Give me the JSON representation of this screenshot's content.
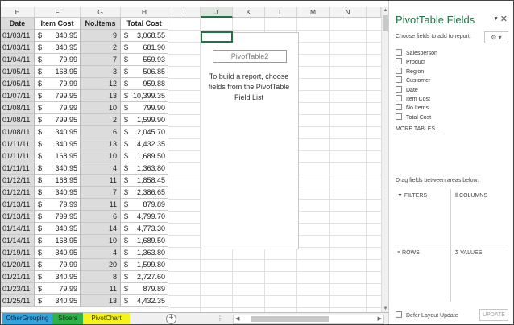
{
  "columns": [
    "E",
    "F",
    "G",
    "H",
    "I",
    "J",
    "K",
    "L",
    "M",
    "N"
  ],
  "table": {
    "headers": [
      "Date",
      "Item Cost",
      "No.Items",
      "Total Cost"
    ],
    "currency_symbol": "$",
    "rows": [
      [
        "01/03/11",
        "340.95",
        "9",
        "3,068.55"
      ],
      [
        "01/03/11",
        "340.95",
        "2",
        "681.90"
      ],
      [
        "01/04/11",
        "79.99",
        "7",
        "559.93"
      ],
      [
        "01/05/11",
        "168.95",
        "3",
        "506.85"
      ],
      [
        "01/05/11",
        "79.99",
        "12",
        "959.88"
      ],
      [
        "01/07/11",
        "799.95",
        "13",
        "10,399.35"
      ],
      [
        "01/08/11",
        "79.99",
        "10",
        "799.90"
      ],
      [
        "01/08/11",
        "799.95",
        "2",
        "1,599.90"
      ],
      [
        "01/08/11",
        "340.95",
        "6",
        "2,045.70"
      ],
      [
        "01/11/11",
        "340.95",
        "13",
        "4,432.35"
      ],
      [
        "01/11/11",
        "168.95",
        "10",
        "1,689.50"
      ],
      [
        "01/11/11",
        "340.95",
        "4",
        "1,363.80"
      ],
      [
        "01/12/11",
        "168.95",
        "11",
        "1,858.45"
      ],
      [
        "01/12/11",
        "340.95",
        "7",
        "2,386.65"
      ],
      [
        "01/13/11",
        "79.99",
        "11",
        "879.89"
      ],
      [
        "01/13/11",
        "799.95",
        "6",
        "4,799.70"
      ],
      [
        "01/14/11",
        "340.95",
        "14",
        "4,773.30"
      ],
      [
        "01/14/11",
        "168.95",
        "10",
        "1,689.50"
      ],
      [
        "01/19/11",
        "340.95",
        "4",
        "1,363.80"
      ],
      [
        "01/20/11",
        "79.99",
        "20",
        "1,599.80"
      ],
      [
        "01/21/11",
        "340.95",
        "8",
        "2,727.60"
      ],
      [
        "01/23/11",
        "79.99",
        "11",
        "879.89"
      ],
      [
        "01/25/11",
        "340.95",
        "13",
        "4,432.35"
      ]
    ]
  },
  "pivot_placeholder": {
    "name": "PivotTable2",
    "message": "To build a report, choose fields from the PivotTable Field List"
  },
  "pane": {
    "title": "PivotTable Fields",
    "choose_label": "Choose fields to add to report:",
    "fields": [
      "Salesperson",
      "Product",
      "Region",
      "Customer",
      "Date",
      "Item Cost",
      "No.Items",
      "Total Cost"
    ],
    "more_tables": "MORE TABLES...",
    "drag_label": "Drag fields between areas below:",
    "areas": {
      "filters": "FILTERS",
      "columns": "COLUMNS",
      "rows": "ROWS",
      "values": "VALUES"
    },
    "defer_label": "Defer Layout Update",
    "update_label": "UPDATE"
  },
  "sheet_tabs": [
    {
      "label": "OtherGrouping",
      "color": "#34a3d9"
    },
    {
      "label": "Slicers",
      "color": "#2fb24a"
    },
    {
      "label": "PivotChart",
      "color": "#f5f21c"
    }
  ],
  "accent_color": "#217346",
  "icons": {
    "close": "close-icon",
    "settings": "gear-icon",
    "add_sheet": "plus-icon"
  }
}
